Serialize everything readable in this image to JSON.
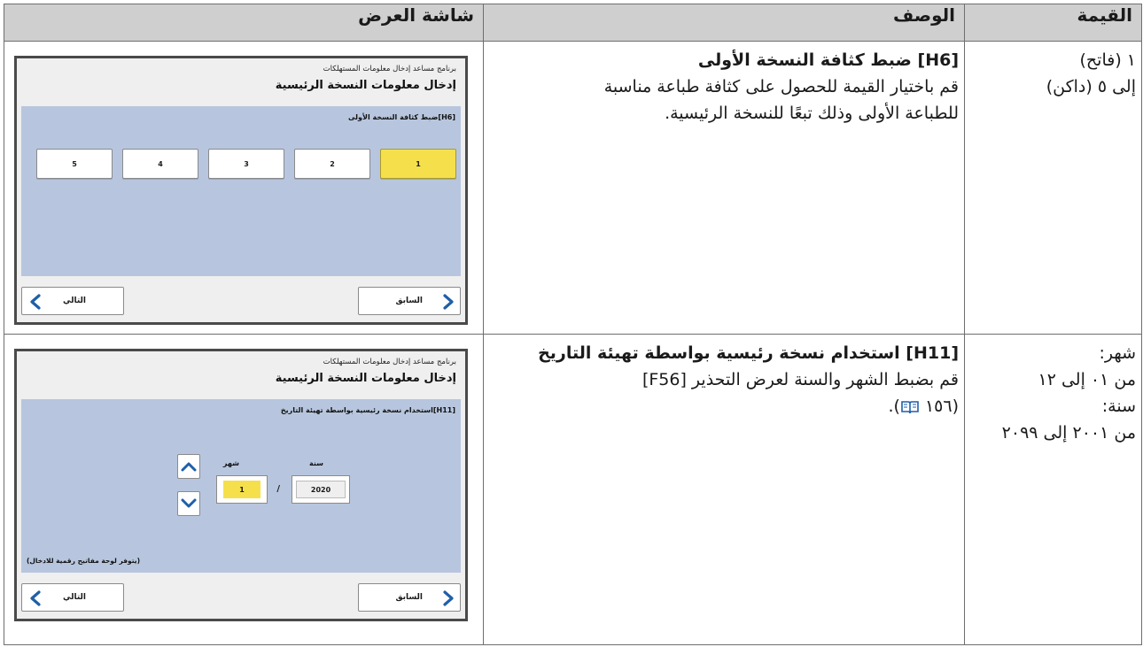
{
  "headers": {
    "screen": "شاشة العرض",
    "description": "الوصف",
    "value": "القيمة"
  },
  "rows": [
    {
      "value_lines": [
        "١ (فاتح)",
        "إلى ٥ (داكن)"
      ],
      "desc_title": "[H6] ضبط كثافة النسخة الأولى",
      "desc_lines": [
        "قم باختيار القيمة للحصول على كثافة طباعة مناسبة",
        "للطباعة الأولى وذلك تبعًا للنسخة الرئيسية."
      ],
      "screen": {
        "app_title": "برنامج مساعد إدخال معلومات المستهلكات",
        "title": "إدخال معلومات النسخة الرئيسية",
        "subtitle": "[H6]ضبط كثافة النسخة الأولى",
        "options": [
          "1",
          "2",
          "3",
          "4",
          "5"
        ],
        "selected": "1",
        "prev_label": "السابق",
        "next_label": "التالي"
      }
    },
    {
      "value_lines": [
        "شهر:",
        "من ٠١ إلى ١٢",
        "سنة:",
        "من ٢٠٠١ إلى ٢٠٩٩"
      ],
      "desc_title": "[H11] استخدام نسخة رئيسية بواسطة تهيئة التاريخ",
      "desc_lines": [
        "قم بضبط الشهر والسنة لعرض التحذير [F56]",
        "(١٥٦ ",
        ")."
      ],
      "screen": {
        "app_title": "برنامج مساعد إدخال معلومات المستهلكات",
        "title": "إدخال معلومات النسخة الرئيسية",
        "subtitle": "[H11]استخدام نسخة رئيسية بواسطة تهيئة التاريخ",
        "month_label": "شهر",
        "year_label": "سنة",
        "month_value": "1",
        "year_value": "2020",
        "separator": "/",
        "hint": "(يتوفر لوحة مفاتيح رقمية للادخال)",
        "prev_label": "السابق",
        "next_label": "التالي"
      }
    }
  ],
  "icons": {
    "chevron": "chevron-icon",
    "book": "book-icon",
    "up": "arrow-up-icon",
    "down": "arrow-down-icon"
  },
  "colors": {
    "header_bg": "#cfcfcf",
    "screen_area": "#b7c6de",
    "selected": "#f5e04b",
    "chevron": "#1f5fa8"
  }
}
